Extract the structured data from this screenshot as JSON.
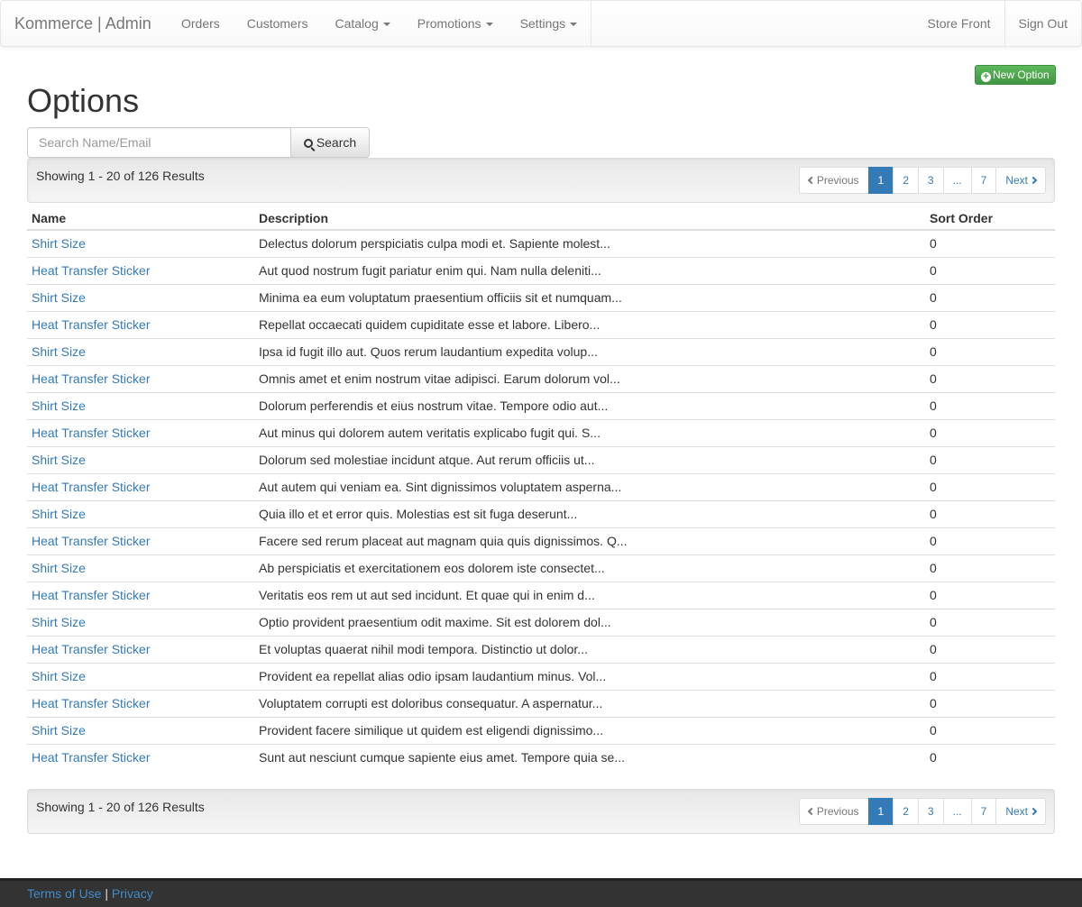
{
  "navbar": {
    "brand": "Kommerce | Admin",
    "items": [
      {
        "label": "Orders"
      },
      {
        "label": "Customers"
      },
      {
        "label": "Catalog"
      },
      {
        "label": "Promotions"
      },
      {
        "label": "Settings"
      }
    ],
    "right": [
      {
        "label": "Store Front"
      },
      {
        "label": "Sign Out"
      }
    ]
  },
  "page": {
    "title": "Options",
    "new_button": "New Option",
    "search": {
      "placeholder": "Search Name/Email",
      "value": "",
      "button": "Search"
    }
  },
  "results": {
    "showing": "Showing 1 - 20 of 126 Results",
    "pagination": {
      "previous": "Previous",
      "pages": [
        "1",
        "2",
        "3",
        "...",
        "7"
      ],
      "next": "Next",
      "active": "1"
    }
  },
  "table": {
    "headers": [
      "Name",
      "Description",
      "Sort Order"
    ],
    "rows": [
      {
        "name": "Shirt Size",
        "description": "Delectus dolorum perspiciatis culpa modi et. Sapiente molest...",
        "sort": "0"
      },
      {
        "name": "Heat Transfer Sticker",
        "description": "Aut quod nostrum fugit pariatur enim qui. Nam nulla deleniti...",
        "sort": "0"
      },
      {
        "name": "Shirt Size",
        "description": "Minima ea eum voluptatum praesentium officiis sit et numquam...",
        "sort": "0"
      },
      {
        "name": "Heat Transfer Sticker",
        "description": "Repellat occaecati quidem cupiditate esse et labore. Libero...",
        "sort": "0"
      },
      {
        "name": "Shirt Size",
        "description": "Ipsa id fugit illo aut. Quos rerum laudantium expedita volup...",
        "sort": "0"
      },
      {
        "name": "Heat Transfer Sticker",
        "description": "Omnis amet et enim nostrum vitae adipisci. Earum dolorum vol...",
        "sort": "0"
      },
      {
        "name": "Shirt Size",
        "description": "Dolorum perferendis et eius nostrum vitae. Tempore odio aut...",
        "sort": "0"
      },
      {
        "name": "Heat Transfer Sticker",
        "description": "Aut minus qui dolorem autem veritatis explicabo fugit qui. S...",
        "sort": "0"
      },
      {
        "name": "Shirt Size",
        "description": "Dolorum sed molestiae incidunt atque. Aut rerum officiis ut...",
        "sort": "0"
      },
      {
        "name": "Heat Transfer Sticker",
        "description": "Aut autem qui veniam ea. Sint dignissimos voluptatem asperna...",
        "sort": "0"
      },
      {
        "name": "Shirt Size",
        "description": "Quia illo et et error quis. Molestias est sit fuga deserunt...",
        "sort": "0"
      },
      {
        "name": "Heat Transfer Sticker",
        "description": "Facere sed rerum placeat aut magnam quia quis dignissimos. Q...",
        "sort": "0"
      },
      {
        "name": "Shirt Size",
        "description": "Ab perspiciatis et exercitationem eos dolorem iste consectet...",
        "sort": "0"
      },
      {
        "name": "Heat Transfer Sticker",
        "description": "Veritatis eos rem ut aut sed incidunt. Et quae qui in enim d...",
        "sort": "0"
      },
      {
        "name": "Shirt Size",
        "description": "Optio provident praesentium odit maxime. Sit est dolorem dol...",
        "sort": "0"
      },
      {
        "name": "Heat Transfer Sticker",
        "description": "Et voluptas quaerat nihil modi tempora. Distinctio ut dolor...",
        "sort": "0"
      },
      {
        "name": "Shirt Size",
        "description": "Provident ea repellat alias odio ipsam laudantium minus. Vol...",
        "sort": "0"
      },
      {
        "name": "Heat Transfer Sticker",
        "description": "Voluptatem corrupti est doloribus consequatur. A aspernatur...",
        "sort": "0"
      },
      {
        "name": "Shirt Size",
        "description": "Provident facere similique ut quidem est eligendi dignissimo...",
        "sort": "0"
      },
      {
        "name": "Heat Transfer Sticker",
        "description": "Sunt aut nesciunt cumque sapiente eius amet. Tempore quia se...",
        "sort": "0"
      }
    ]
  },
  "footer": {
    "terms": "Terms of Use",
    "separator": "|",
    "privacy": "Privacy"
  },
  "colors": {
    "link": "#337ab7",
    "primary": "#337ab7",
    "success": "#5cb85c",
    "footer_bg": "#333333"
  },
  "icons": {
    "new_button": "plus-circle-icon",
    "search_button": "search-icon",
    "previous": "chevron-left-icon",
    "next": "chevron-right-icon",
    "dropdown": "caret-down-icon"
  }
}
